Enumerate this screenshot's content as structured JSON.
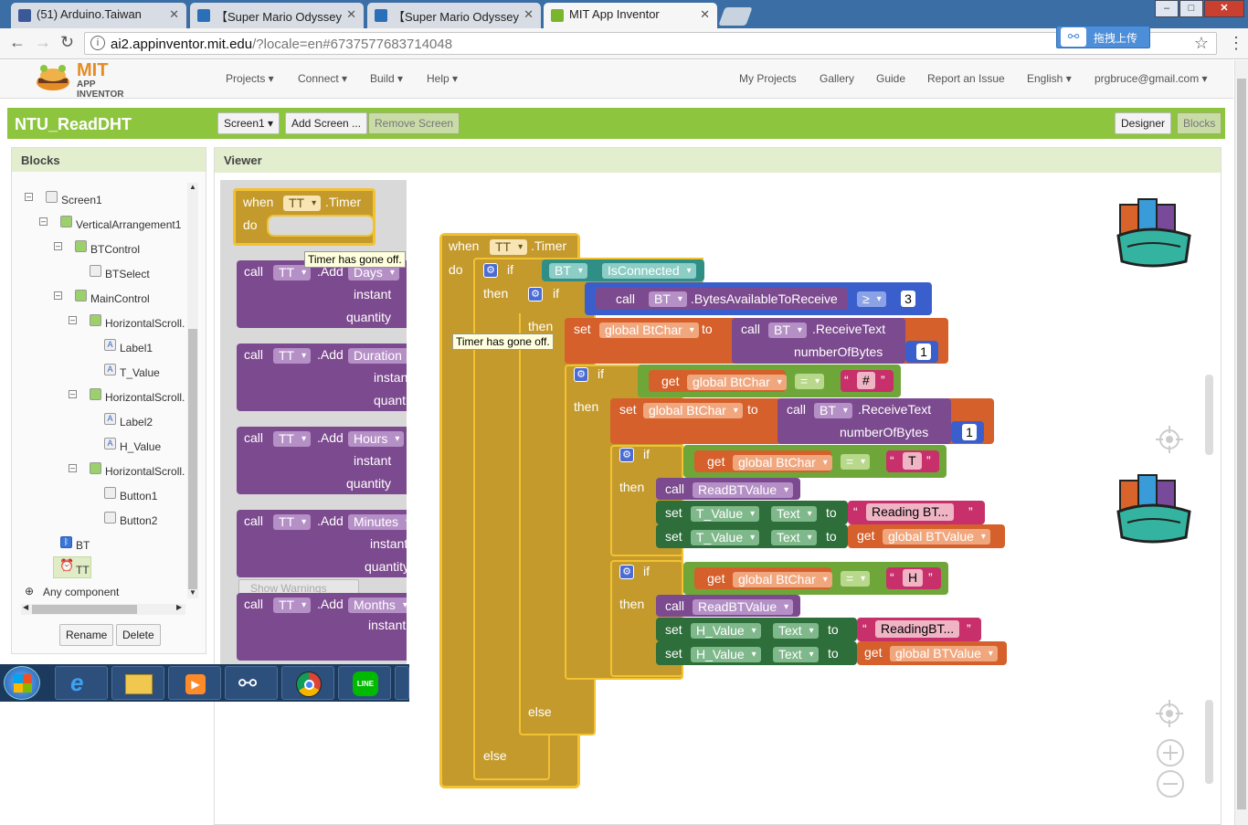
{
  "browser": {
    "tabs": [
      {
        "title": "(51) Arduino.Taiwan",
        "favicon_color": "#3b5998"
      },
      {
        "title": "【Super Mario Odyssey",
        "favicon_color": "#2a6fb8"
      },
      {
        "title": "【Super Mario Odyssey",
        "favicon_color": "#2a6fb8"
      },
      {
        "title": "MIT App Inventor",
        "favicon_color": "#7bb52b"
      }
    ],
    "url_host": "ai2.appinventor.mit.edu",
    "url_rest": "/?locale=en#6737577683714048",
    "upload_label": "拖拽上传",
    "window_controls": {
      "minimize": "–",
      "maximize": "□",
      "close": "✕"
    }
  },
  "ai": {
    "logo_top": "MIT",
    "logo_bottom": "APP INVENTOR",
    "menu_left": [
      "Projects ▾",
      "Connect ▾",
      "Build ▾",
      "Help ▾"
    ],
    "menu_right": [
      "My Projects",
      "Gallery",
      "Guide",
      "Report an Issue",
      "English ▾",
      "prgbruce@gmail.com ▾"
    ],
    "project_name": "NTU_ReadDHT",
    "screen_select": "Screen1 ▾",
    "add_screen": "Add Screen ...",
    "remove_screen": "Remove Screen",
    "designer": "Designer",
    "blocks": "Blocks",
    "accent": "#8dc53e"
  },
  "blocks_panel": {
    "title": "Blocks",
    "tree": [
      "Screen1",
      "VerticalArrangement1",
      "BTControl",
      "BTSelect",
      "MainControl",
      "HorizontalScroll.",
      "Label1",
      "T_Value",
      "HorizontalScroll.",
      "Label2",
      "H_Value",
      "HorizontalScroll.",
      "Button1",
      "Button2",
      "BT",
      "TT"
    ],
    "any_component": "Any component",
    "rename": "Rename",
    "delete": "Delete"
  },
  "viewer": {
    "title": "Viewer",
    "show_warnings": "Show Warnings",
    "tooltip": "Timer has gone off.",
    "flyout": {
      "when": "when",
      "do": "do",
      "tt": "TT",
      "timer": ".Timer",
      "calls": [
        {
          "call": "call",
          "comp": "TT",
          "method": ".Add",
          "unit": "Days",
          "p1": "instant",
          "p2": "quantity"
        },
        {
          "call": "call",
          "comp": "TT",
          "method": ".Add",
          "unit": "Duration",
          "p1": "instant",
          "p2": "quantity"
        },
        {
          "call": "call",
          "comp": "TT",
          "method": ".Add",
          "unit": "Hours",
          "p1": "instant",
          "p2": "quantity"
        },
        {
          "call": "call",
          "comp": "TT",
          "method": ".Add",
          "unit": "Minutes",
          "p1": "instant",
          "p2": "quantity"
        },
        {
          "call": "call",
          "comp": "TT",
          "method": ".Add",
          "unit": "Months",
          "p1": "instant",
          "p2": ""
        }
      ]
    },
    "workspace": {
      "when": "when",
      "tt": "TT",
      "timer": ".Timer",
      "do": "do",
      "if": "if",
      "then": "then",
      "else": "else",
      "bt": "BT",
      "is_connected": "IsConnected",
      "call": "call",
      "bytes_avail": ".BytesAvailableToReceive",
      "ge": "≥",
      "three": "3",
      "one": "1",
      "set": "set",
      "get": "get",
      "to": "to",
      "global_btchar": "global BtChar",
      "global_btvalue": "global BTValue",
      "receive_text": ".ReceiveText",
      "number_of_bytes": "numberOfBytes",
      "eq": "=",
      "hash": "#",
      "t": "T",
      "h": "H",
      "read_bt_value": "ReadBTValue",
      "t_value": "T_Value",
      "h_value": "H_Value",
      "text_prop": "Text",
      "reading_t": "Reading BT...",
      "reading_h": "ReadingBT...",
      "quote_open": "“",
      "quote_close": "”"
    }
  }
}
